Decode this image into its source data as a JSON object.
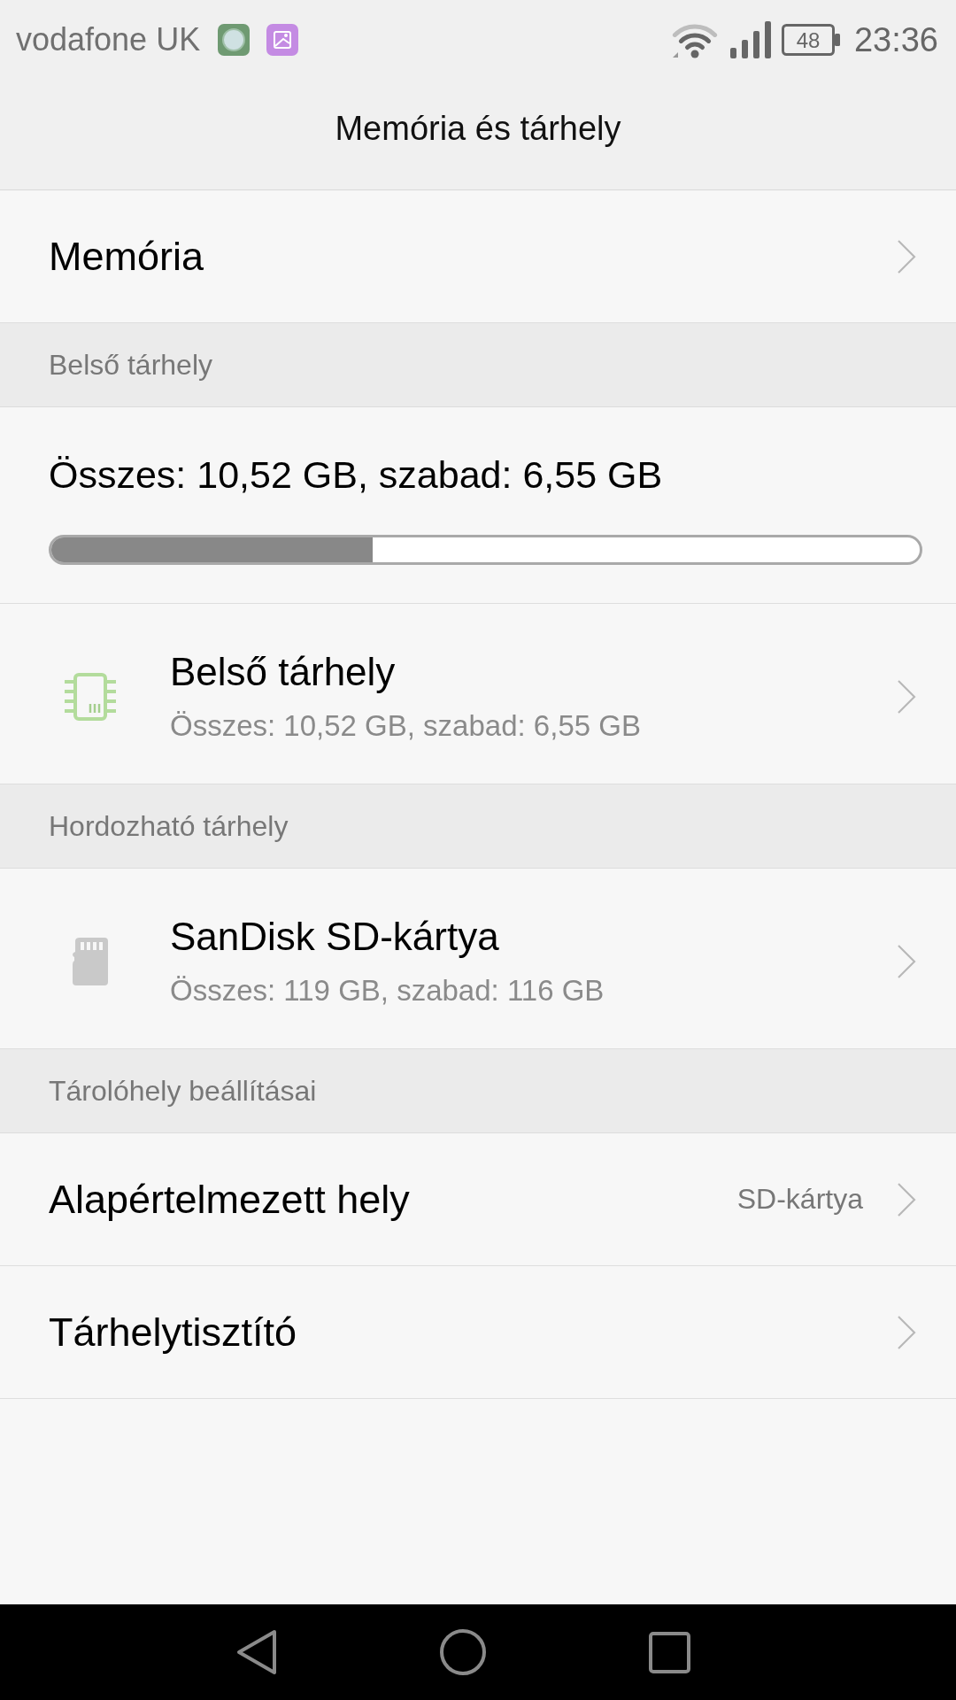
{
  "status_bar": {
    "carrier": "vodafone UK",
    "battery": "48",
    "time": "23:36"
  },
  "title_bar": {
    "title": "Memória és tárhely"
  },
  "rows": [
    {
      "kind": "link",
      "label": "Memória"
    },
    {
      "kind": "header",
      "label": "Belső tárhely"
    },
    {
      "kind": "usage",
      "summary": "Összes: 10,52 GB, szabad: 6,55 GB",
      "level": 0.37
    },
    {
      "kind": "internal",
      "title": "Belső tárhely",
      "detail": "Összes: 10,52 GB, szabad: 6,55 GB"
    },
    {
      "kind": "header",
      "label": "Hordozható tárhely"
    },
    {
      "kind": "portable",
      "title": "SanDisk SD-kártya",
      "detail": "Összes: 119 GB, szabad: 116 GB"
    },
    {
      "kind": "header",
      "label": "Tárolóhely beállításai"
    },
    {
      "kind": "link",
      "label": "Alapértelmezett hely",
      "value": "SD-kártya"
    },
    {
      "kind": "link",
      "label": "Tárhelytisztító"
    }
  ]
}
